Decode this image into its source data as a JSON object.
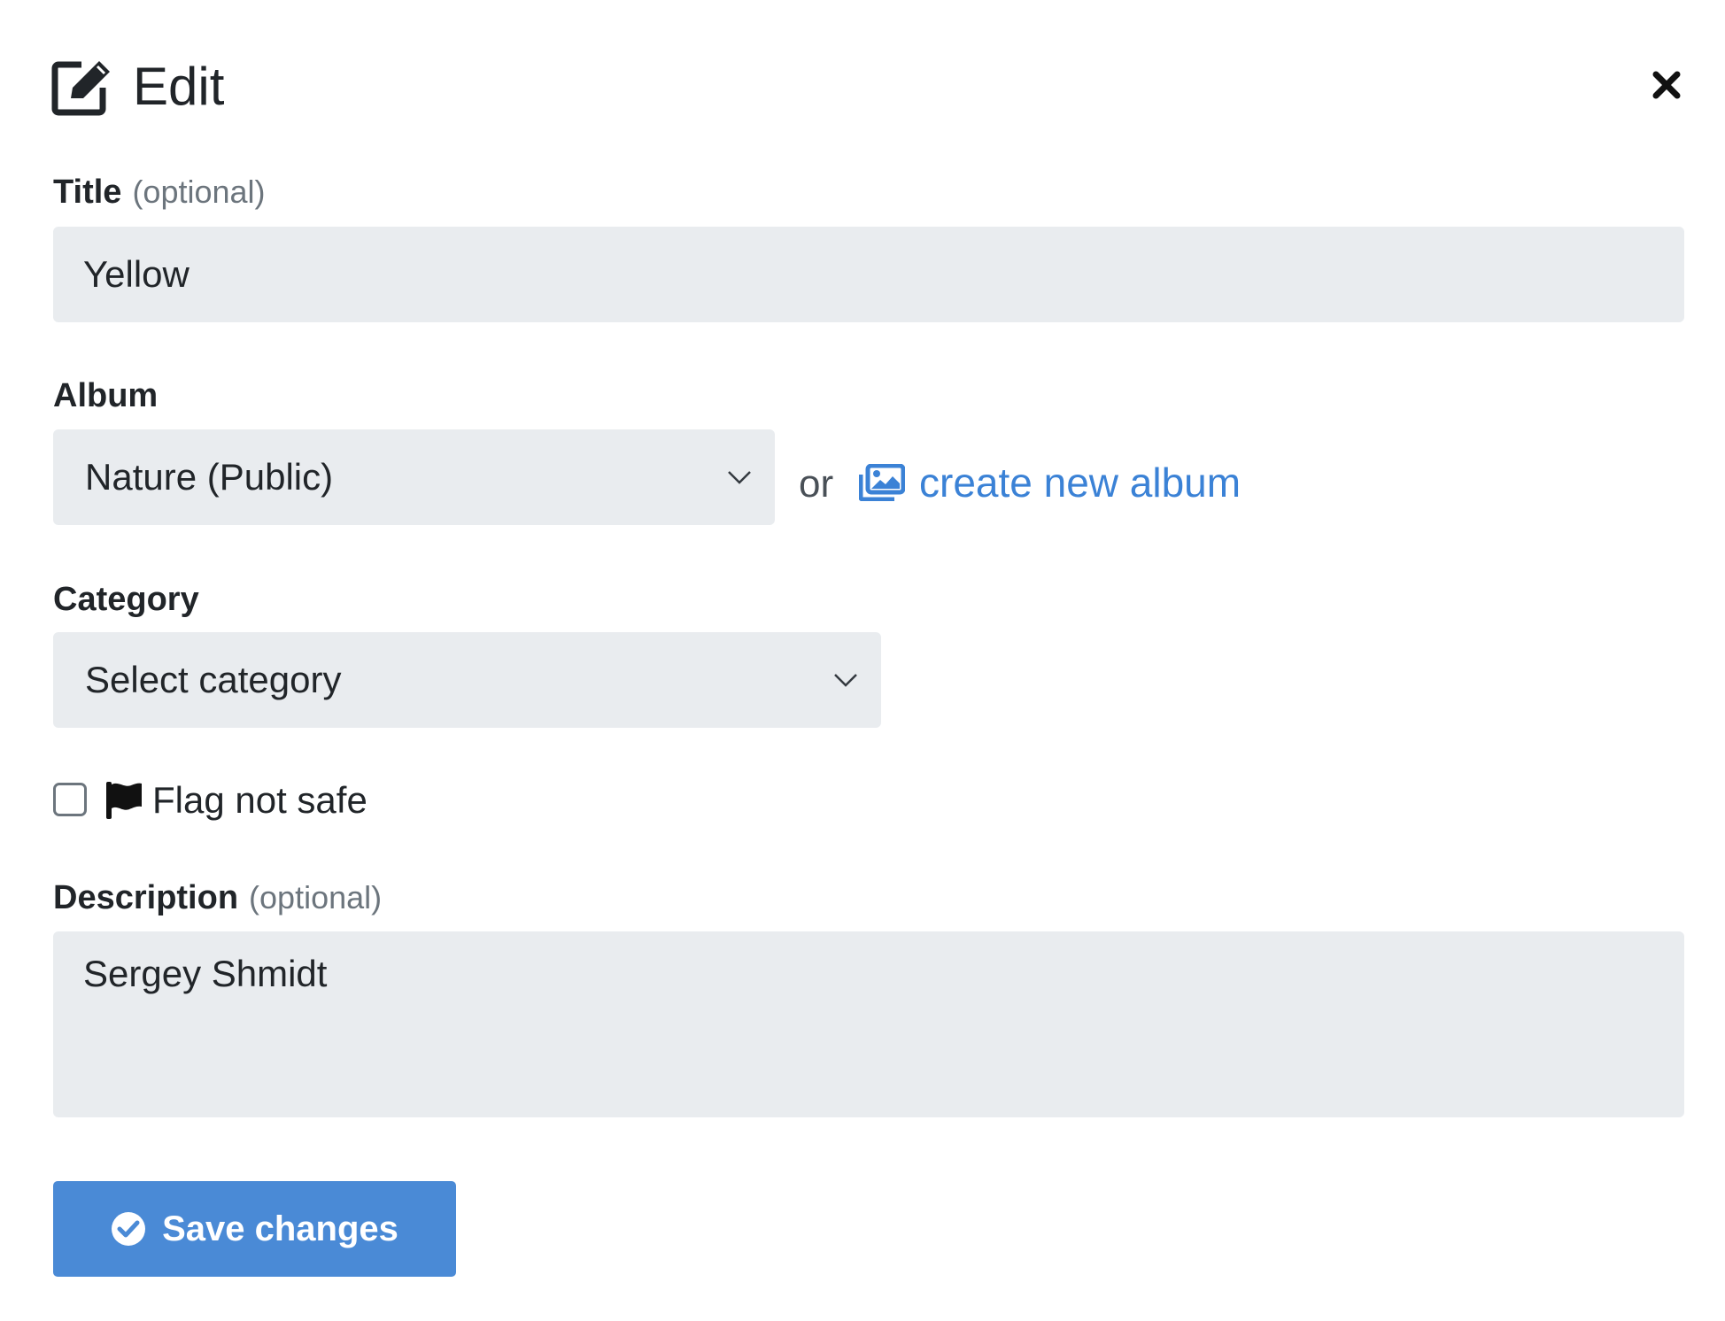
{
  "dialog": {
    "title": "Edit",
    "icons": {
      "title_icon": "edit-icon",
      "close_icon": "close-icon"
    }
  },
  "form": {
    "title_field": {
      "label": "Title",
      "hint": "(optional)",
      "value": "Yellow"
    },
    "album_field": {
      "label": "Album",
      "selected": "Nature (Public)",
      "or_text": "or",
      "create_link": "create new album",
      "link_icon": "images-icon"
    },
    "category_field": {
      "label": "Category",
      "selected": "Select category"
    },
    "flag": {
      "label": "Flag not safe",
      "checked": false,
      "icon": "flag-icon"
    },
    "description_field": {
      "label": "Description",
      "hint": "(optional)",
      "value": "Sergey Shmidt"
    }
  },
  "actions": {
    "save_label": "Save changes",
    "save_icon": "check-circle-icon"
  },
  "colors": {
    "accent": "#4a8ad6",
    "link": "#3b82d6",
    "input_bg": "#e9ecef",
    "muted": "#6c757d"
  }
}
